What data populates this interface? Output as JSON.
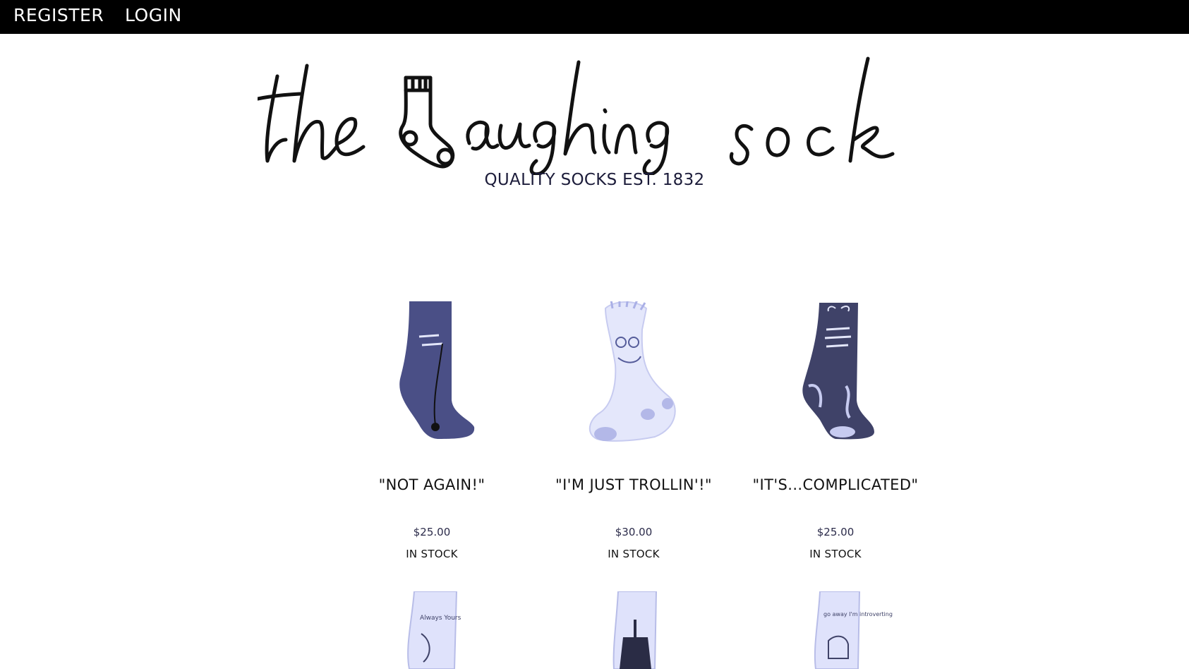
{
  "nav": {
    "register": "REGISTER",
    "login": "LOGIN"
  },
  "brand": {
    "logo_text": "the laughing sock",
    "tagline": "QUALITY SOCKS EST. 1832"
  },
  "colors": {
    "topbar": "#000000",
    "text": "#111111",
    "sock_dark": "#4a4f86",
    "sock_light": "#e4e7fb"
  },
  "products": [
    {
      "name": "\"NOT AGAIN!\"",
      "price": "$25.00",
      "stock": "IN STOCK",
      "image_icon": "sock-blue-icon"
    },
    {
      "name": "\"I'M JUST TROLLIN'!\"",
      "price": "$30.00",
      "stock": "IN STOCK",
      "image_icon": "sock-troll-icon"
    },
    {
      "name": "\"IT'S...COMPLICATED\"",
      "price": "$25.00",
      "stock": "IN STOCK",
      "image_icon": "sock-dark-floral-icon"
    }
  ],
  "products_row2": [
    {
      "image_icon": "sock-always-icon",
      "text": "Always Yours"
    },
    {
      "image_icon": "sock-candle-icon"
    },
    {
      "image_icon": "sock-go-away-icon",
      "text": "go away I'm introverting"
    }
  ]
}
